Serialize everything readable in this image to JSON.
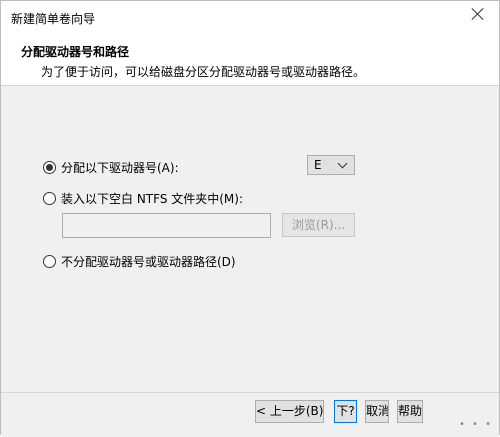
{
  "window": {
    "title": "新建简单卷向导"
  },
  "header": {
    "title": "分配驱动器号和路径",
    "subtitle": "为了便于访问，可以给磁盘分区分配驱动器号或驱动器路径。"
  },
  "options": {
    "assign_letter": {
      "label": "分配以下驱动器号(A):",
      "selected": true
    },
    "mount_folder": {
      "label": "装入以下空白 NTFS 文件夹中(M):",
      "selected": false
    },
    "no_assign": {
      "label": "不分配驱动器号或驱动器路径(D)",
      "selected": false
    }
  },
  "drive_letter": {
    "value": "E"
  },
  "path": {
    "value": ""
  },
  "browse_button": {
    "label": "浏览(R)..."
  },
  "footer": {
    "back_label": "< 上一步(B)",
    "next_label": "下?",
    "cancel_label": "取消",
    "help_label": "帮助"
  },
  "watermark": {
    "text": "• • •"
  },
  "colors": {
    "content_bg": "#f0f0f0",
    "accent": "#0078d7"
  }
}
